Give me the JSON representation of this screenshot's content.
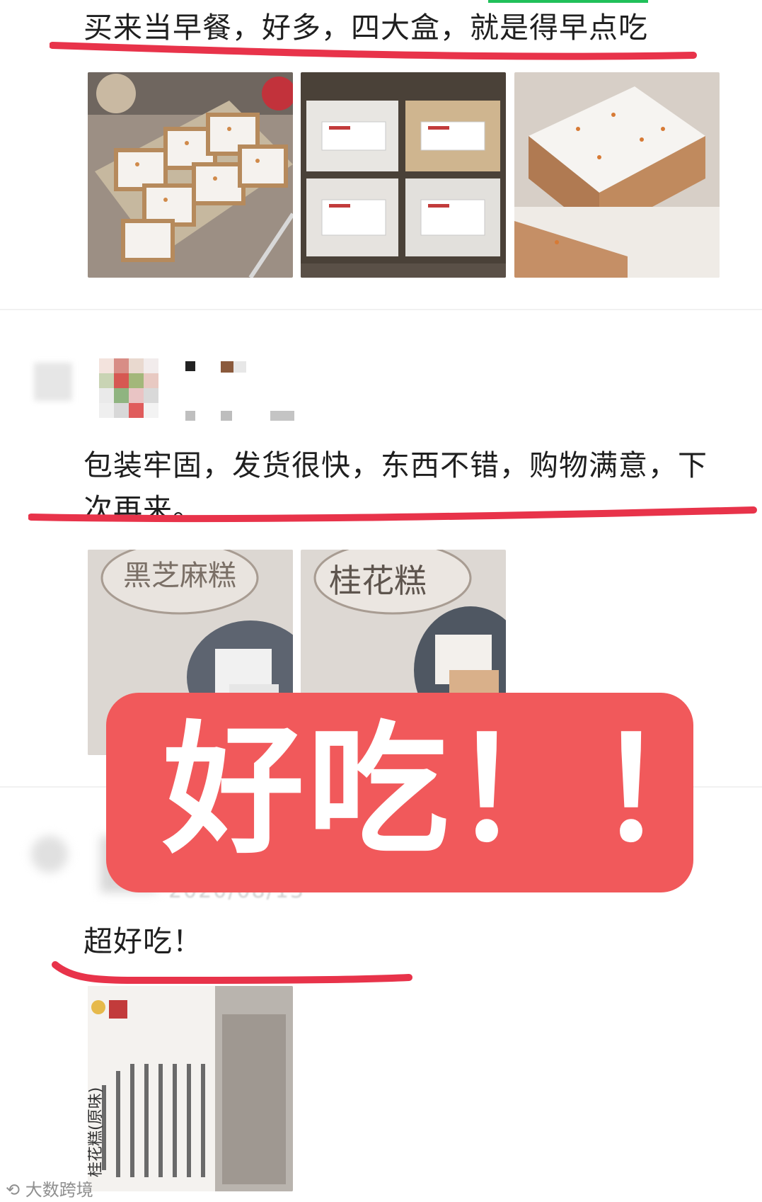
{
  "reviews": [
    {
      "text": "买来当早餐，好多，四大盒，就是得早点吃"
    },
    {
      "text_line1": "包装牢固，发货很快，东西不错，购物满意，下",
      "text_line2": "次再来。"
    },
    {
      "text": "超好吃！",
      "date": "2020/08/13"
    }
  ],
  "overlay": {
    "text": "好吃！！"
  },
  "watermark": {
    "text": "大数跨境"
  },
  "colors": {
    "highlight_red": "#e8334a",
    "banner": "#f1595b",
    "accent_green": "#20c05a"
  },
  "photo_labels": {
    "box1_top": "黑芝麻糕",
    "box2_top": "桂花糕",
    "product_label": "桂花糕(原味)"
  }
}
